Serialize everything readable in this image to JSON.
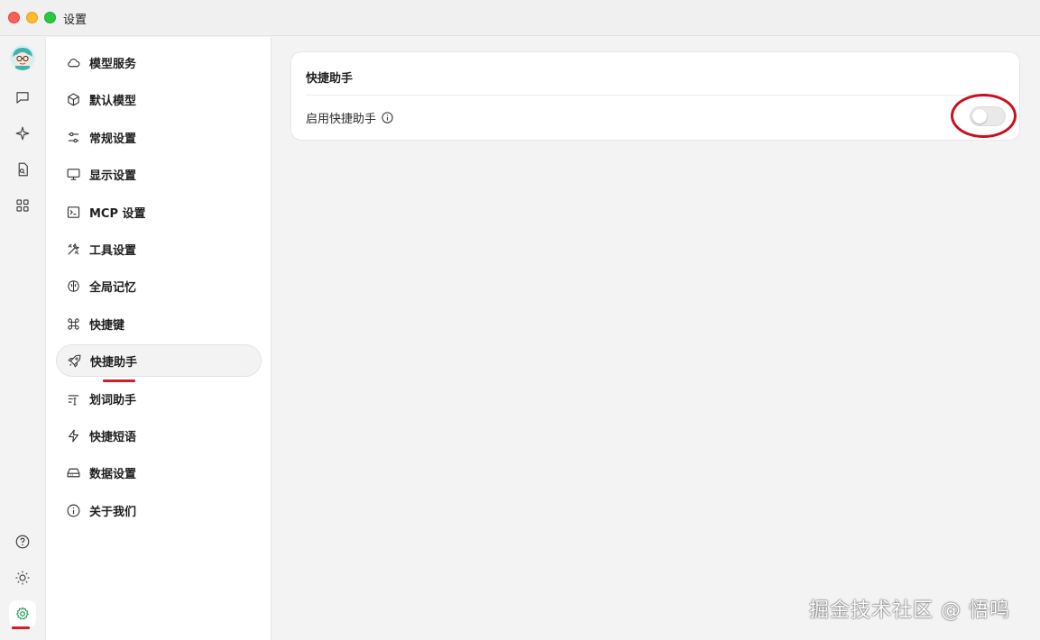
{
  "window": {
    "title": "设置"
  },
  "rail": {
    "items": [
      {
        "name": "avatar"
      },
      {
        "name": "chat-icon"
      },
      {
        "name": "sparkle-icon"
      },
      {
        "name": "file-search-icon"
      },
      {
        "name": "apps-grid-icon"
      },
      {
        "name": "help-icon"
      },
      {
        "name": "sun-icon"
      },
      {
        "name": "settings-gear-icon",
        "active": true
      }
    ]
  },
  "nav": {
    "items": [
      {
        "label": "模型服务",
        "icon": "cloud-icon"
      },
      {
        "label": "默认模型",
        "icon": "cube-icon"
      },
      {
        "label": "常规设置",
        "icon": "sliders-icon"
      },
      {
        "label": "显示设置",
        "icon": "monitor-icon"
      },
      {
        "label": "MCP 设置",
        "icon": "terminal-icon"
      },
      {
        "label": "工具设置",
        "icon": "tools-icon"
      },
      {
        "label": "全局记忆",
        "icon": "brain-icon"
      },
      {
        "label": "快捷键",
        "icon": "command-icon"
      },
      {
        "label": "快捷助手",
        "icon": "rocket-icon",
        "active": true
      },
      {
        "label": "划词助手",
        "icon": "text-select-icon"
      },
      {
        "label": "快捷短语",
        "icon": "zap-icon"
      },
      {
        "label": "数据设置",
        "icon": "hard-drive-icon"
      },
      {
        "label": "关于我们",
        "icon": "info-icon"
      }
    ]
  },
  "main": {
    "card_title": "快捷助手",
    "enable_label": "启用快捷助手",
    "enable_value": false
  },
  "colors": {
    "accent": "#28a35a",
    "annotation": "#c8101f"
  },
  "watermark": "掘金技术社区 @ 悟鸣"
}
